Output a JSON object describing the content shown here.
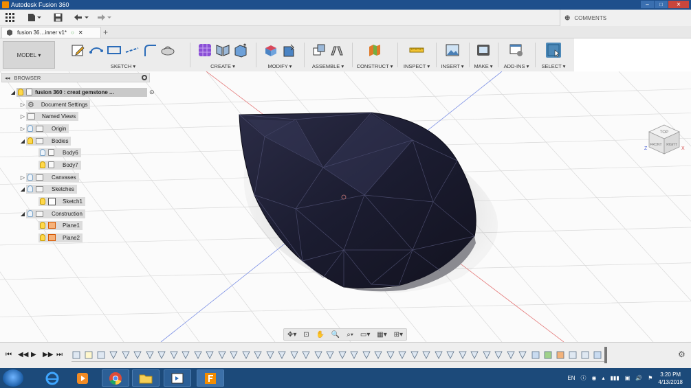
{
  "window": {
    "title": "Autodesk Fusion 360",
    "buttons": [
      "–",
      "□",
      "✕"
    ]
  },
  "comments": {
    "label": "COMMENTS"
  },
  "document_tab": {
    "label": "fusion 36…inner v1*"
  },
  "toolbar": {
    "workspace": "MODEL",
    "groups": [
      {
        "label": "SKETCH",
        "icons": [
          "create-sketch-icon",
          "arc-icon",
          "rectangle-icon",
          "line-icon",
          "fillet-sketch-icon",
          "loft-icon"
        ]
      },
      {
        "label": "CREATE",
        "icons": [
          "box-grid-icon",
          "mirror-icon",
          "extrude-icon"
        ]
      },
      {
        "label": "MODIFY",
        "icons": [
          "press-pull-icon",
          "shell-icon"
        ]
      },
      {
        "label": "ASSEMBLE",
        "icons": [
          "new-component-icon",
          "joint-icon"
        ]
      },
      {
        "label": "CONSTRUCT",
        "icons": [
          "construct-plane-icon"
        ]
      },
      {
        "label": "INSPECT",
        "icons": [
          "measure-icon"
        ]
      },
      {
        "label": "INSERT",
        "icons": [
          "insert-image-icon"
        ]
      },
      {
        "label": "MAKE",
        "icons": [
          "print-3d-icon"
        ]
      },
      {
        "label": "ADD-INS",
        "icons": [
          "scripts-icon"
        ]
      },
      {
        "label": "SELECT",
        "icons": [
          "select-icon"
        ]
      }
    ]
  },
  "browser": {
    "title": "BROWSER",
    "root": "fusion 360 : creat gemstone ...",
    "items": [
      {
        "label": "Document Settings"
      },
      {
        "label": "Named Views"
      },
      {
        "label": "Origin"
      },
      {
        "label": "Bodies"
      },
      {
        "label": "Body6"
      },
      {
        "label": "Body7"
      },
      {
        "label": "Canvases"
      },
      {
        "label": "Sketches"
      },
      {
        "label": "Sketch1"
      },
      {
        "label": "Construction"
      },
      {
        "label": "Plane1"
      },
      {
        "label": "Plane2"
      }
    ]
  },
  "viewcube": {
    "top": "TOP",
    "front": "FRONT",
    "right": "RIGHT",
    "x": "X",
    "z": "Z"
  },
  "taskbar": {
    "language": "EN",
    "time": "3:20 PM",
    "date": "4/13/2018"
  }
}
